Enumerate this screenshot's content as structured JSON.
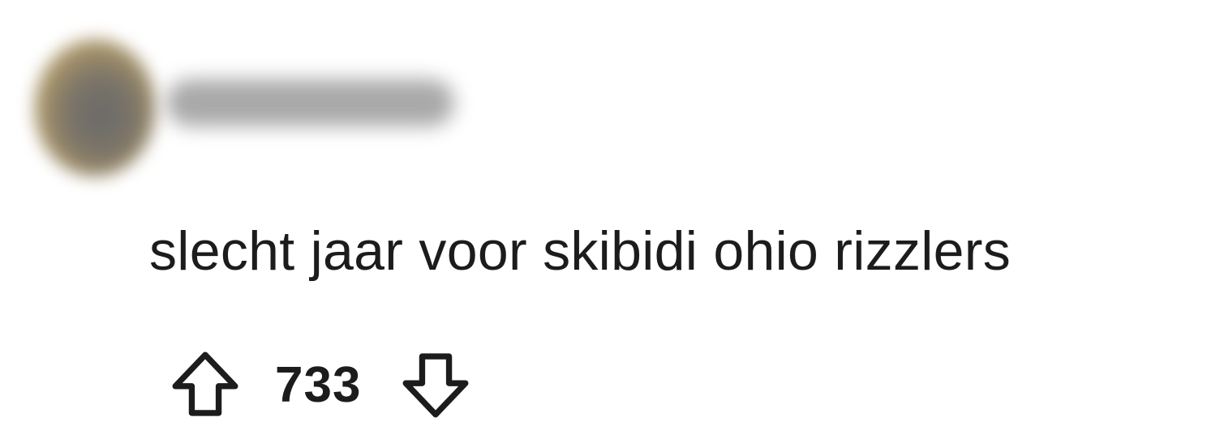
{
  "comment": {
    "body": "slecht jaar voor skibidi ohio rizzlers",
    "score": "733"
  },
  "icons": {
    "upvote": "arrow-up-outline-icon",
    "downvote": "arrow-down-outline-icon"
  },
  "colors": {
    "text": "#1c1c1c",
    "background": "#ffffff"
  }
}
